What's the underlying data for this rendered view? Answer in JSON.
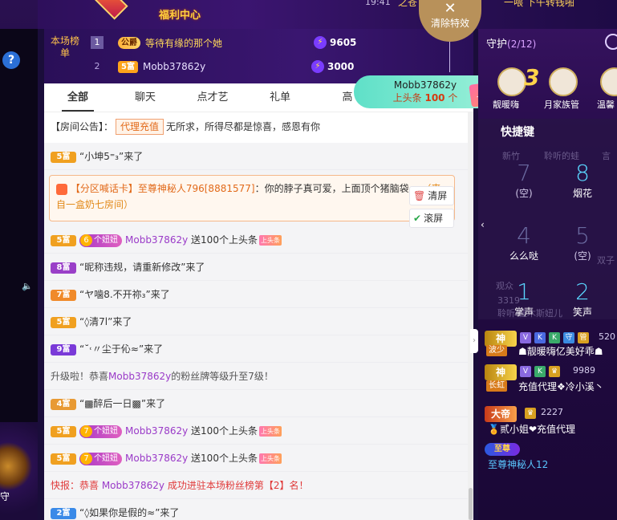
{
  "top": {
    "left_fragment": "亲",
    "month_badge": "月",
    "welfare": "福利中心",
    "time": "19:41",
    "hot_fragment": "之苍",
    "right_fragment": "一喂 下午转钱啪"
  },
  "clear_effects": {
    "icon": "✕",
    "label": "清除特效"
  },
  "rank": {
    "label": "本场榜单",
    "rows": [
      {
        "num": "1",
        "badge": "公爵",
        "name": "等待有缘的那个她",
        "score": "9605"
      },
      {
        "num": "2",
        "badge": "5富",
        "name": "Mobb37862y",
        "score": "3000"
      }
    ]
  },
  "toast": {
    "name": "Mobb37862y",
    "prefix": "上头条",
    "count": "100",
    "suffix": "个",
    "tag": "上头条"
  },
  "tabs": [
    "全部",
    "聊天",
    "点才艺",
    "礼单",
    "高"
  ],
  "notice": {
    "prefix": "【房间公告】：",
    "tag": "代理充值",
    "text": "无所求，所得尽都是惊喜，感恩有你"
  },
  "messages": {
    "m1": {
      "lv": "5富",
      "text": "“小坤5⁼₃”来了"
    },
    "loud": {
      "card": "【分区喊话卡】",
      "sender": "至尊神秘人796",
      "uid": "[8881577]",
      "text": "：你的脖子真可爱，上面顶个猪脑袋。",
      "from": "（来自一盒奶七房间）"
    },
    "m2": {
      "lv": "5富",
      "pill": "个妞妞",
      "user": "Mobb37862y",
      "text": "送100个上头条"
    },
    "m3": {
      "lv": "8富",
      "text": "“昵称违规，请重新修改”来了"
    },
    "m4": {
      "lv": "7富",
      "text": "“ヤ噛8.不开祢₃”来了"
    },
    "m5": {
      "lv": "5富",
      "text": "“◊清7l”来了"
    },
    "m6": {
      "lv": "9富",
      "text": "“˘˓〃尘于伈≈”来了"
    },
    "m7": {
      "pre": "升级啦！恭喜",
      "user": "Mobb37862y",
      "post": "的粉丝牌等级升至7级！"
    },
    "m8": {
      "lv": "4富",
      "text": "“▩醉后一日▩”来了"
    },
    "m9": {
      "lv": "5富",
      "pill": "个妞妞",
      "user": "Mobb37862y",
      "text": "送100个上头条"
    },
    "m10": {
      "lv": "5富",
      "pill": "个妞妞",
      "user": "Mobb37862y",
      "text": "送100个上头条"
    },
    "m11": {
      "pre": "快报：恭喜 ",
      "user": "Mobb37862y",
      "post": " 成功进驻本场粉丝榜第【2】名！"
    },
    "m12": {
      "lv": "2富",
      "text": "“◊如果你是假的≈”来了"
    }
  },
  "side_buttons": {
    "clear": "清屏",
    "scroll": "滚屏"
  },
  "headline_tag": "上头条",
  "right": {
    "guard_title": "守护",
    "guard_count": "(2/12)",
    "avatars": [
      "靓暖嗨",
      "月家族管",
      "温馨"
    ],
    "avatar_extra": "3",
    "quick_title": "快捷键",
    "keys": [
      {
        "num": "7",
        "label": "(空)"
      },
      {
        "num": "8",
        "label": "烟花"
      },
      {
        "num": "4",
        "label": "么么哒"
      },
      {
        "num": "5",
        "label": "(空)"
      },
      {
        "num": "1",
        "label": "掌声"
      },
      {
        "num": "2",
        "label": "笑声"
      }
    ],
    "ghost_texts": [
      "新竹",
      "聆听的蛙",
      "言",
      "双子",
      "观众",
      "3319",
      "聆听-佳木斯妞儿"
    ],
    "ranks": [
      {
        "title": "神",
        "num": "520",
        "tag": "波少",
        "name": "☗靓暖嗨亿美好乖☗"
      },
      {
        "title": "神",
        "num": "9989",
        "tag": "长虹",
        "name": "充值代理❖冷小溪丶"
      },
      {
        "title": "大帝",
        "num": "2227",
        "name": "贰小姐❤充值代理"
      },
      {
        "title": "至尊",
        "name": "至尊神秘人12"
      }
    ]
  },
  "left": {
    "help": "?",
    "guard": "守"
  }
}
